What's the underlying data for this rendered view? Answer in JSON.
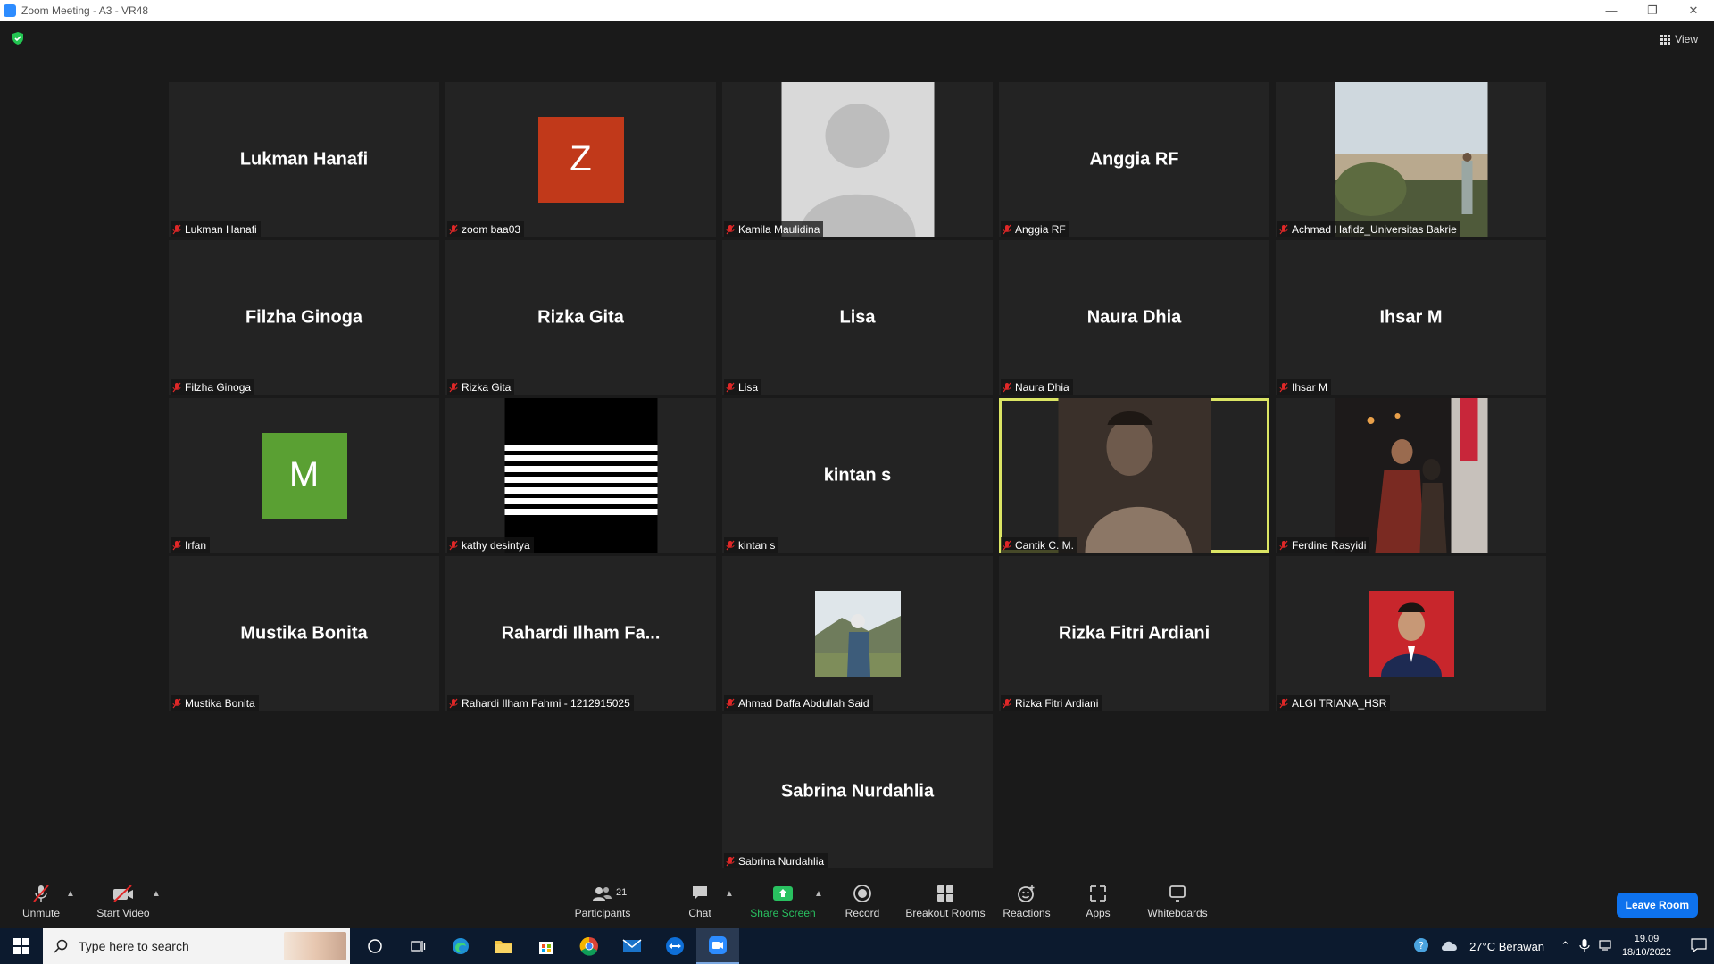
{
  "window": {
    "title": "Zoom Meeting - A3 - VR48",
    "minimize_icon": "minimize-icon",
    "restore_icon": "restore-icon",
    "close_icon": "close-icon"
  },
  "header": {
    "view_label": "View"
  },
  "participants": [
    {
      "label": "Lukman Hanafi",
      "display": "Lukman Hanafi",
      "type": "name"
    },
    {
      "label": "zoom baa03",
      "display": "Z",
      "type": "avatar",
      "color": "#c1391a"
    },
    {
      "label": "Kamila Maulidina",
      "display": "",
      "type": "placeholder-photo"
    },
    {
      "label": "Anggia RF",
      "display": "Anggia RF",
      "type": "name"
    },
    {
      "label": "Achmad Hafidz_Universitas Bakrie",
      "display": "",
      "type": "photo-landscape"
    },
    {
      "label": "Filzha Ginoga",
      "display": "Filzha Ginoga",
      "type": "name"
    },
    {
      "label": "Rizka Gita",
      "display": "Rizka Gita",
      "type": "name"
    },
    {
      "label": "Lisa",
      "display": "Lisa",
      "type": "name"
    },
    {
      "label": "Naura Dhia",
      "display": "Naura Dhia",
      "type": "name"
    },
    {
      "label": "Ihsar M",
      "display": "Ihsar M",
      "type": "name"
    },
    {
      "label": "Irfan",
      "display": "M",
      "type": "avatar",
      "color": "#5aa033"
    },
    {
      "label": "kathy desintya",
      "display": "",
      "type": "stripes"
    },
    {
      "label": "kintan s",
      "display": "kintan s",
      "type": "name"
    },
    {
      "label": "Cantik C. M.",
      "display": "",
      "type": "photo-portrait",
      "active": true
    },
    {
      "label": "Ferdine Rasyidi",
      "display": "",
      "type": "photo-couple"
    },
    {
      "label": "Mustika Bonita",
      "display": "Mustika Bonita",
      "type": "name"
    },
    {
      "label": "Rahardi Ilham Fahmi - 1212915025",
      "display": "Rahardi Ilham Fa...",
      "type": "name"
    },
    {
      "label": "Ahmad Daffa Abdullah Said",
      "display": "",
      "type": "photo-small-outdoor"
    },
    {
      "label": "Rizka Fitri Ardiani",
      "display": "Rizka Fitri Ardiani",
      "type": "name"
    },
    {
      "label": "ALGI TRIANA_HSR",
      "display": "",
      "type": "photo-small-red"
    },
    {
      "label": "Sabrina Nurdahlia",
      "display": "Sabrina Nurdahlia",
      "type": "name"
    }
  ],
  "toolbar": {
    "unmute": "Unmute",
    "start_video": "Start Video",
    "participants": "Participants",
    "participants_count": "21",
    "chat": "Chat",
    "share_screen": "Share Screen",
    "record": "Record",
    "breakout_rooms": "Breakout Rooms",
    "reactions": "Reactions",
    "apps": "Apps",
    "whiteboards": "Whiteboards",
    "leave_room": "Leave Room",
    "share_color": "#29c160",
    "leave_color": "#0e72ed"
  },
  "taskbar": {
    "search_placeholder": "Type here to search",
    "weather": "27°C  Berawan",
    "time": "19.09",
    "date": "18/10/2022"
  }
}
